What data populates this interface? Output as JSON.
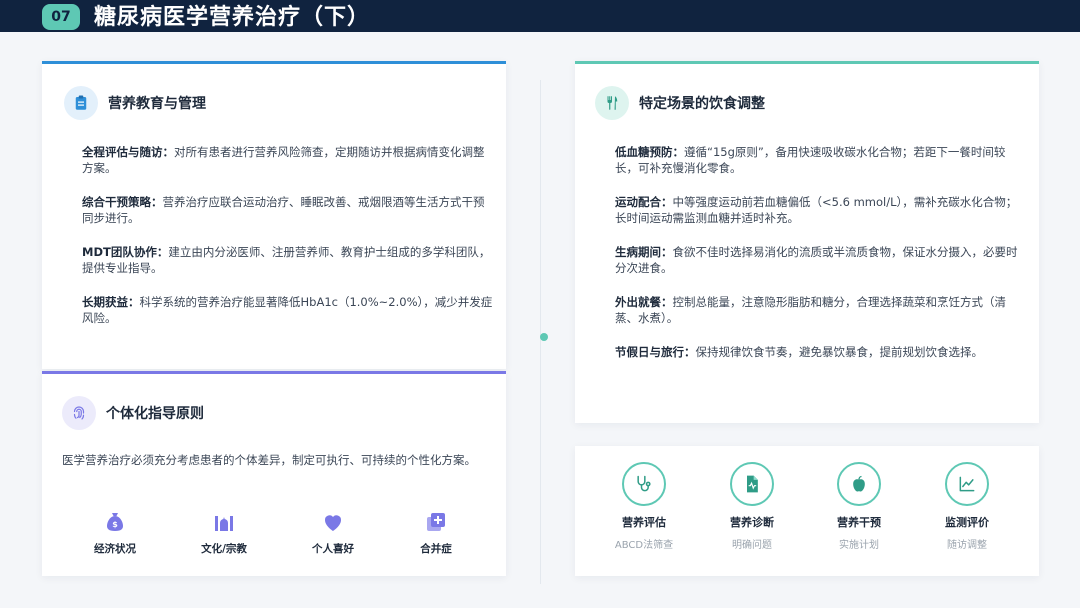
{
  "header": {
    "number": "07",
    "title": "糖尿病医学营养治疗（下）"
  },
  "education": {
    "title": "营养教育与管理",
    "icon": "clipboard-icon",
    "items": [
      {
        "label": "全程评估与随访：",
        "text": "对所有患者进行营养风险筛查，定期随访并根据病情变化调整方案。"
      },
      {
        "label": "综合干预策略：",
        "text": "营养治疗应联合运动治疗、睡眠改善、戒烟限酒等生活方式干预同步进行。"
      },
      {
        "label": "MDT团队协作：",
        "text": "建立由内分泌医师、注册营养师、教育护士组成的多学科团队，提供专业指导。"
      },
      {
        "label": "长期获益：",
        "text": "科学系统的营养治疗能显著降低HbA1c（1.0%~2.0%），减少并发症风险。"
      }
    ]
  },
  "individual": {
    "title": "个体化指导原则",
    "icon": "fingerprint-icon",
    "note": "医学营养治疗必须充分考虑患者的个体差异，制定可执行、可持续的个性化方案。",
    "factors": [
      {
        "label": "经济状况",
        "icon": "money-bag-icon"
      },
      {
        "label": "文化/宗教",
        "icon": "mosque-icon"
      },
      {
        "label": "个人喜好",
        "icon": "heart-icon"
      },
      {
        "label": "合并症",
        "icon": "medical-plus-icon"
      }
    ]
  },
  "scenarios": {
    "title": "特定场景的饮食调整",
    "icon": "utensils-icon",
    "items": [
      {
        "label": "低血糖预防：",
        "text": "遵循“15g原则”，备用快速吸收碳水化合物；若距下一餐时间较长，可补充慢消化零食。"
      },
      {
        "label": "运动配合：",
        "text": "中等强度运动前若血糖偏低（<5.6 mmol/L），需补充碳水化合物；长时间运动需监测血糖并适时补充。"
      },
      {
        "label": "生病期间：",
        "text": "食欲不佳时选择易消化的流质或半流质食物，保证水分摄入，必要时分次进食。"
      },
      {
        "label": "外出就餐：",
        "text": "控制总能量，注意隐形脂肪和糖分，合理选择蔬菜和烹饪方式（清蒸、水煮）。"
      },
      {
        "label": "节假日与旅行：",
        "text": "保持规律饮食节奏，避免暴饮暴食，提前规划饮食选择。"
      }
    ]
  },
  "process": {
    "steps": [
      {
        "title": "营养评估",
        "sub": "ABCD法筛查",
        "icon": "stethoscope-icon"
      },
      {
        "title": "营养诊断",
        "sub": "明确问题",
        "icon": "medical-file-icon"
      },
      {
        "title": "营养干预",
        "sub": "实施计划",
        "icon": "apple-icon"
      },
      {
        "title": "监测评价",
        "sub": "随访调整",
        "icon": "chart-line-icon"
      }
    ]
  },
  "colors": {
    "navy": "#10233f",
    "teal": "#5ec8b4",
    "blue": "#2e8fd8",
    "purple": "#7a78e6"
  }
}
